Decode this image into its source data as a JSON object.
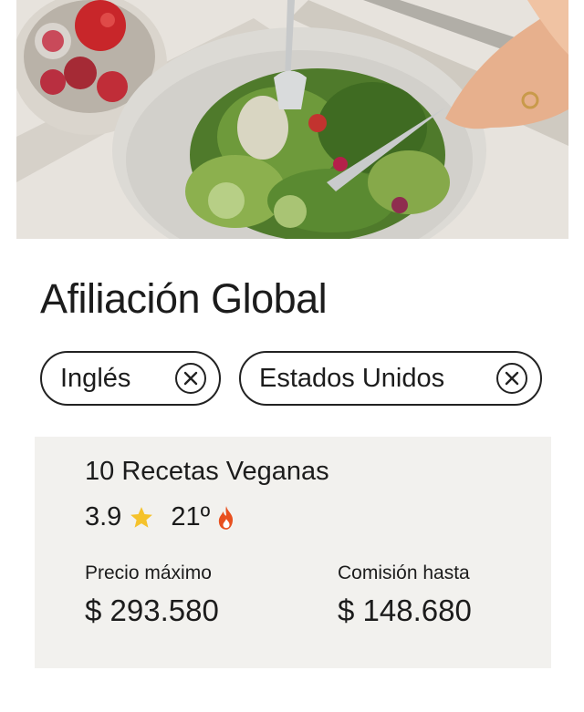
{
  "page": {
    "title": "Afiliación Global"
  },
  "filters": [
    {
      "label": "Inglés",
      "remove_icon": "close-circle-icon"
    },
    {
      "label": "Estados Unidos",
      "remove_icon": "close-circle-icon"
    }
  ],
  "product": {
    "name": "10 Recetas Veganas",
    "rating": "3.9",
    "rank": "21º",
    "max_price_label": "Precio máximo",
    "max_price_value": "$ 293.580",
    "commission_label": "Comisión hasta",
    "commission_value": "$ 148.680"
  },
  "colors": {
    "star": "#f5c22b",
    "fire": "#e8501f",
    "card_bg": "#f2f1ee"
  }
}
